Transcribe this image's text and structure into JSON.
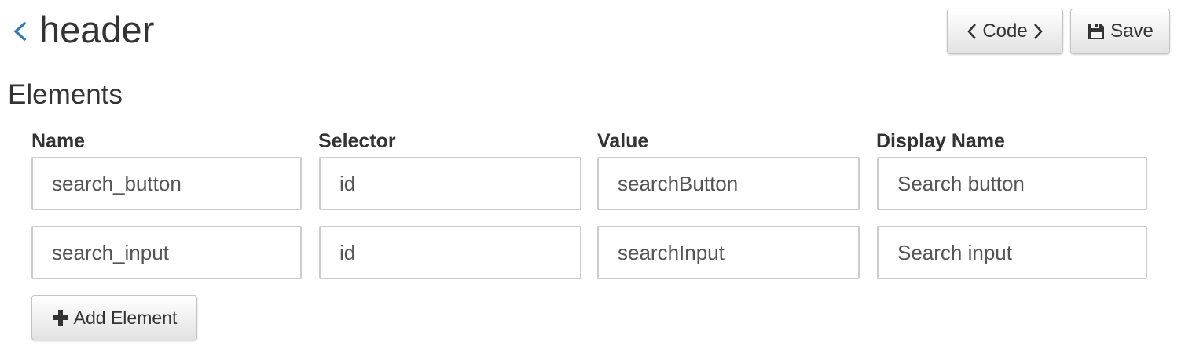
{
  "header": {
    "title": "header",
    "back_icon": "chevron-left-icon",
    "back_icon_color": "#337ab7",
    "code_button_label": "Code",
    "code_button_icons": [
      "chevron-left-icon",
      "chevron-right-icon"
    ],
    "save_button_label": "Save",
    "save_button_icon": "floppy-disk-icon"
  },
  "elements": {
    "section_title": "Elements",
    "columns": [
      "Name",
      "Selector",
      "Value",
      "Display Name"
    ],
    "rows": [
      {
        "name": "search_button",
        "selector": "id",
        "value": "searchButton",
        "display_name": "Search button"
      },
      {
        "name": "search_input",
        "selector": "id",
        "value": "searchInput",
        "display_name": "Search input"
      }
    ],
    "add_button_label": "Add Element",
    "add_button_icon": "plus-icon"
  }
}
